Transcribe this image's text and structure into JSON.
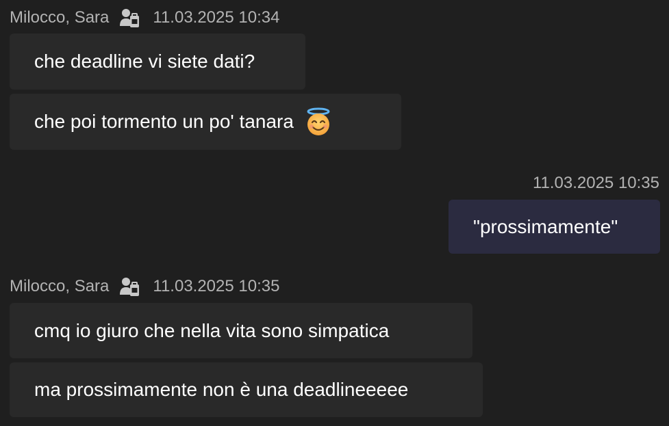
{
  "messages": [
    {
      "sender": "Milocco, Sara",
      "sender_icon": "external-user-icon",
      "timestamp": "11.03.2025 10:34",
      "bubbles": [
        {
          "text": "che deadline vi siete dati?"
        },
        {
          "text": "che poi tormento un po' tanara",
          "emoji": "smiling-face-with-halo"
        }
      ]
    },
    {
      "own": true,
      "timestamp": "11.03.2025 10:35",
      "bubbles": [
        {
          "text": "\"prossimamente\""
        }
      ]
    },
    {
      "sender": "Milocco, Sara",
      "sender_icon": "external-user-icon",
      "timestamp": "11.03.2025 10:35",
      "bubbles": [
        {
          "text": "cmq io giuro che nella vita sono simpatica"
        },
        {
          "text": "ma prossimamente non è una deadlineeeee"
        }
      ]
    }
  ],
  "colors": {
    "background": "#1f1f1f",
    "incoming_bubble": "#292929",
    "outgoing_bubble": "#2b2b40",
    "meta_text": "#b3b3b3"
  }
}
